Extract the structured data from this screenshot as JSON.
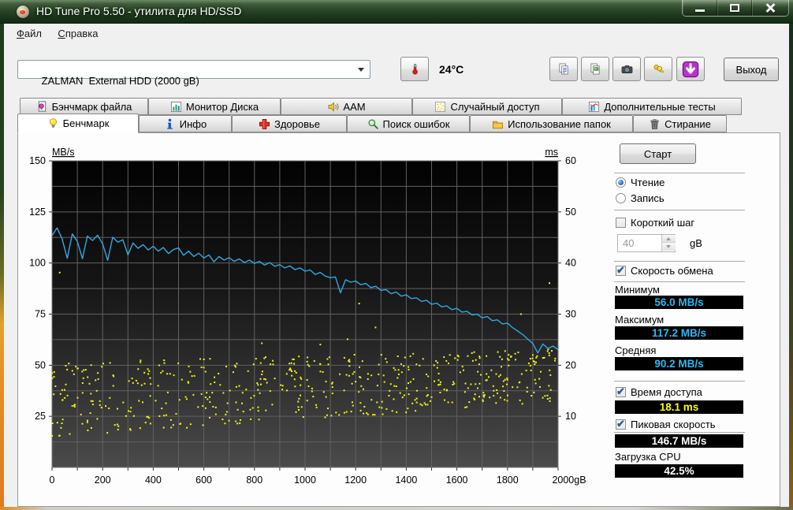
{
  "window": {
    "title": "HD Tune Pro 5.50 - утилита для HD/SSD"
  },
  "menu": {
    "items": [
      "Файл",
      "Справка"
    ]
  },
  "toolbar": {
    "drive_select": "ZALMAN  External HDD (2000 gB)",
    "temperature": "24°C",
    "exit_label": "Выход"
  },
  "tabs": {
    "row1": [
      "Бэнчмарк файла",
      "Монитор Диска",
      "AAM",
      "Случайный доступ",
      "Дополнительные тесты"
    ],
    "row2": [
      "Бенчмарк",
      "Инфо",
      "Здоровье",
      "Поиск ошибок",
      "Использование папок",
      "Стирание"
    ],
    "active": "Бенчмарк"
  },
  "controls": {
    "start_button": "Старт",
    "radio_read": {
      "label": "Чтение",
      "selected": true
    },
    "radio_write": {
      "label": "Запись",
      "selected": false
    },
    "short_stroke": {
      "label": "Короткий шаг",
      "check": "",
      "value": "40",
      "unit": "gB"
    },
    "transfer": {
      "label": "Скорость обмена",
      "check": "✔"
    },
    "minimum": {
      "label": "Минимум",
      "value": "56.0 MB/s"
    },
    "maximum": {
      "label": "Максимум",
      "value": "117.2 MB/s"
    },
    "average": {
      "label": "Средняя",
      "value": "90.2 MB/s"
    },
    "access_time": {
      "label": "Время доступа",
      "check": "✔",
      "value": "18.1 ms"
    },
    "burst_rate": {
      "label": "Пиковая скорость",
      "check": "✔",
      "value": "146.7 MB/s"
    },
    "cpu_usage": {
      "label": "Загрузка CPU",
      "value": "42.5%"
    }
  },
  "value_colors": {
    "transfer": "#2bb8ef",
    "access": "#ffff00",
    "burst": "#ffffff",
    "cpu": "#ffffff"
  },
  "chart_data": {
    "type": "line+scatter",
    "x_axis": {
      "min": 0,
      "max": 2000,
      "gridline_step": 100,
      "tick_labels": [
        "0",
        "200",
        "400",
        "600",
        "800",
        "1000",
        "1200",
        "1400",
        "1600",
        "1800",
        "2000gB"
      ]
    },
    "y_left": {
      "label": "MB/s",
      "min": 0,
      "max": 150,
      "gridline_step": 12.5,
      "ticks": [
        150,
        125,
        100,
        75,
        50,
        25
      ]
    },
    "y_right": {
      "label": "ms",
      "min": 0,
      "max": 60,
      "ticks": [
        60,
        50,
        40,
        30,
        20,
        10
      ]
    },
    "transfer_rate_line": {
      "name": "transfer rate (MB/s)",
      "color": "#2fa9e0",
      "x_start": 0,
      "x_step": 20,
      "values": [
        113.4,
        117.2,
        111.8,
        102.3,
        114.2,
        110.6,
        102.1,
        113.2,
        111.0,
        113.6,
        109.4,
        101.3,
        112.6,
        110.2,
        111.4,
        104.0,
        109.8,
        107.2,
        109.0,
        106.4,
        108.2,
        105.8,
        107.6,
        104.6,
        106.6,
        107.4,
        103.8,
        105.8,
        103.2,
        104.8,
        102.4,
        104.0,
        100.6,
        103.2,
        101.4,
        102.6,
        100.8,
        102.0,
        100.2,
        101.4,
        99.8,
        100.8,
        99.0,
        100.2,
        98.4,
        99.2,
        97.6,
        98.6,
        96.8,
        97.6,
        96.0,
        96.6,
        94.4,
        95.4,
        93.6,
        92.8,
        93.2,
        85.4,
        91.8,
        90.6,
        91.2,
        89.4,
        90.0,
        88.0,
        88.6,
        86.6,
        87.0,
        85.0,
        85.8,
        83.8,
        84.4,
        82.6,
        83.0,
        81.2,
        81.8,
        79.8,
        80.4,
        78.6,
        79.0,
        77.2,
        77.8,
        76.0,
        76.4,
        74.6,
        75.0,
        73.2,
        73.8,
        71.8,
        72.2,
        70.2,
        70.6,
        68.4,
        66.8,
        65.0,
        62.8,
        60.6,
        56.0,
        60.4,
        58.2,
        59.4,
        57.6
      ]
    },
    "access_time_scatter": {
      "name": "access time (ms)",
      "color": "#f4f316",
      "count": 560,
      "seed": 20150512,
      "ms_floor_start": 5.0,
      "ms_floor_end": 12.0,
      "ms_ceil_start": 20.5,
      "ms_ceil_end": 23.2,
      "outlier_prob": 0.012
    },
    "plot_bg_top": "#020202",
    "plot_bg_bottom": "#4b4b4b",
    "gridline_color": "#616161"
  }
}
